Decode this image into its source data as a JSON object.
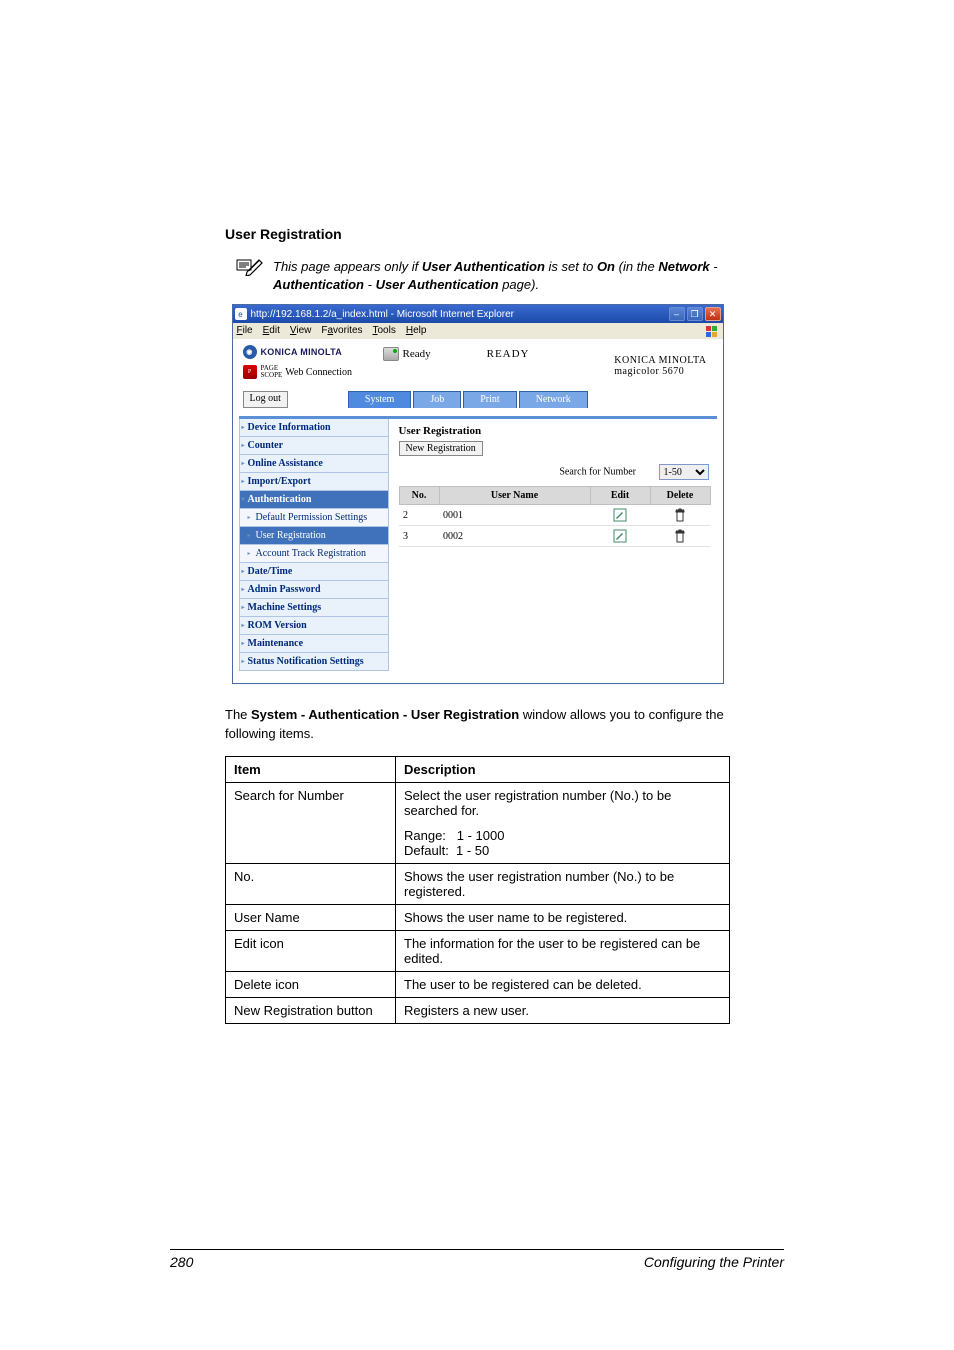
{
  "heading": "User Registration",
  "note": {
    "prefix": "This page appears only if ",
    "b1": "User Authentication",
    "mid1": " is set to ",
    "b2": "On",
    "mid2": " (in the ",
    "b3": "Network",
    "sep1": " - ",
    "b4": "Authentication",
    "sep2": " - ",
    "b5": "User Authentication",
    "suffix": " page)."
  },
  "browser": {
    "titlebar": "http://192.168.1.2/a_index.html - Microsoft Internet Explorer",
    "menus": {
      "file": "File",
      "edit": "Edit",
      "view": "View",
      "favorites": "Favorites",
      "tools": "Tools",
      "help": "Help"
    },
    "brand": "KONICA MINOLTA",
    "pagescope1": "PAGE",
    "pagescope2": "SCOPE",
    "webconn": "Web Connection",
    "ready_small": "Ready",
    "ready_big": "READY",
    "model1": "KONICA MINOLTA",
    "model2": "magicolor 5670",
    "logout": "Log out",
    "tabs": {
      "system": "System",
      "job": "Job",
      "print": "Print",
      "network": "Network"
    }
  },
  "sidebar": {
    "device_info": "Device Information",
    "counter": "Counter",
    "online_assist": "Online Assistance",
    "import_export": "Import/Export",
    "authentication": "Authentication",
    "default_perm": "Default Permission Settings",
    "user_reg": "User Registration",
    "acct_track": "Account Track Registration",
    "date_time": "Date/Time",
    "admin_pwd": "Admin Password",
    "machine_settings": "Machine Settings",
    "rom_version": "ROM Version",
    "maintenance": "Maintenance",
    "status_notif": "Status Notification Settings"
  },
  "panel": {
    "title": "User Registration",
    "new_reg": "New Registration",
    "search_label": "Search for Number",
    "search_value": "1-50",
    "cols": {
      "no": "No.",
      "username": "User Name",
      "edit": "Edit",
      "delete": "Delete"
    },
    "rows": [
      {
        "no": "2",
        "name": "0001"
      },
      {
        "no": "3",
        "name": "0002"
      }
    ]
  },
  "body_text": {
    "pre": "The ",
    "bold": "System - Authentication - User Registration",
    "post": " window allows you to configure the following items."
  },
  "table": {
    "h_item": "Item",
    "h_desc": "Description",
    "rows": {
      "search": {
        "item": "Search for Number",
        "desc1": "Select the user registration number (No.) to be searched for.",
        "range": "Range:   1 - 1000",
        "default": "Default:  1 - 50"
      },
      "no": {
        "item": "No.",
        "desc": "Shows the user registration number (No.) to be registered."
      },
      "username": {
        "item": "User Name",
        "desc": "Shows the user name to be registered."
      },
      "edit": {
        "item": "Edit icon",
        "desc": "The information for the user to be registered can be edited."
      },
      "delete": {
        "item": "Delete icon",
        "desc": "The user to be registered can be deleted."
      },
      "newreg": {
        "item": "New Registration button",
        "desc": "Registers a new user."
      }
    }
  },
  "footer": {
    "page": "280",
    "section": "Configuring the Printer"
  }
}
